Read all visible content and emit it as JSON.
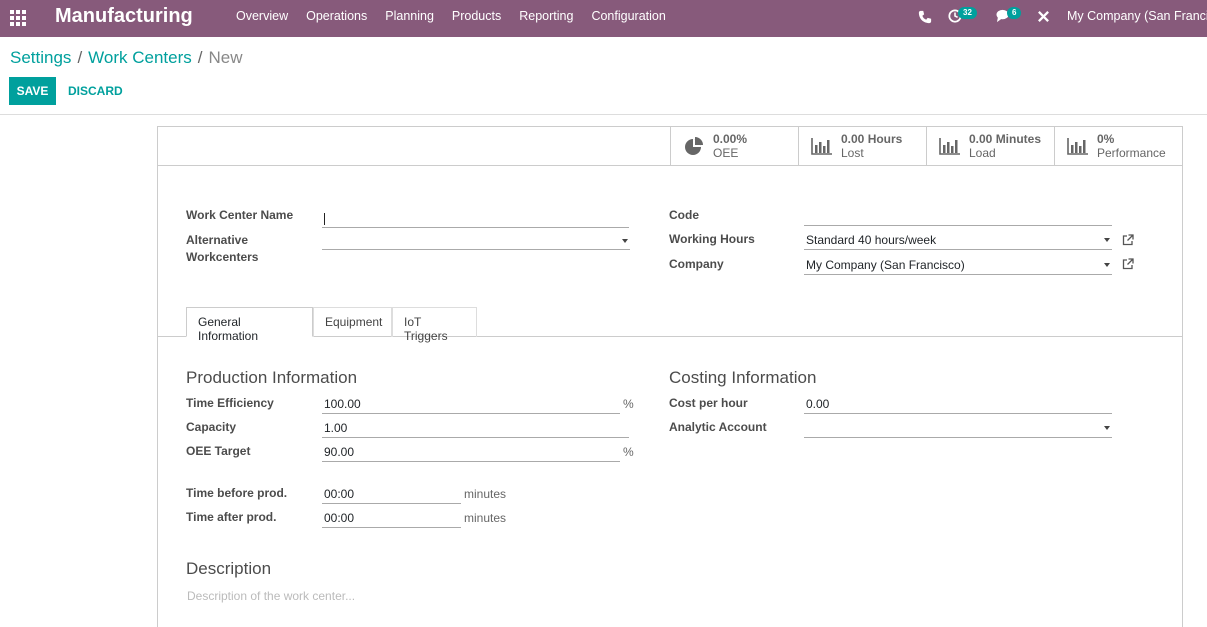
{
  "navbar": {
    "app_name": "Manufacturing",
    "menu": [
      "Overview",
      "Operations",
      "Planning",
      "Products",
      "Reporting",
      "Configuration"
    ],
    "activity_count": "32",
    "chat_count": "6",
    "company": "My Company (San Francisco)"
  },
  "breadcrumb": {
    "items": [
      "Settings",
      "Work Centers"
    ],
    "current": "New"
  },
  "actions": {
    "save": "SAVE",
    "discard": "DISCARD"
  },
  "stats": [
    {
      "value": "0.00%",
      "label": "OEE",
      "icon": "pie-chart-icon"
    },
    {
      "value": "0.00 Hours",
      "label": "Lost",
      "icon": "bar-chart-icon"
    },
    {
      "value": "0.00 Minutes",
      "label": "Load",
      "icon": "bar-chart-icon"
    },
    {
      "value": "0%",
      "label": "Performance",
      "icon": "bar-chart-icon"
    }
  ],
  "header_fields": {
    "work_center_name": {
      "label": "Work Center Name",
      "value": ""
    },
    "alternative_workcenters": {
      "label_line1": "Alternative",
      "label_line2": "Workcenters",
      "value": ""
    },
    "code": {
      "label": "Code",
      "value": ""
    },
    "working_hours": {
      "label": "Working Hours",
      "value": "Standard 40 hours/week"
    },
    "company": {
      "label": "Company",
      "value": "My Company (San Francisco)"
    }
  },
  "tabs": [
    "General Information",
    "Equipment",
    "IoT Triggers"
  ],
  "production": {
    "title": "Production Information",
    "time_efficiency": {
      "label": "Time Efficiency",
      "value": "100.00",
      "unit": "%"
    },
    "capacity": {
      "label": "Capacity",
      "value": "1.00"
    },
    "oee_target": {
      "label": "OEE Target",
      "value": "90.00",
      "unit": "%"
    },
    "time_before": {
      "label": "Time before prod.",
      "value": "00:00",
      "unit": "minutes"
    },
    "time_after": {
      "label": "Time after prod.",
      "value": "00:00",
      "unit": "minutes"
    }
  },
  "costing": {
    "title": "Costing Information",
    "cost_per_hour": {
      "label": "Cost per hour",
      "value": "0.00"
    },
    "analytic_account": {
      "label": "Analytic Account",
      "value": ""
    }
  },
  "description": {
    "title": "Description",
    "placeholder": "Description of the work center..."
  },
  "colors": {
    "navbar": "#875A7B",
    "accent": "#00A09D"
  }
}
